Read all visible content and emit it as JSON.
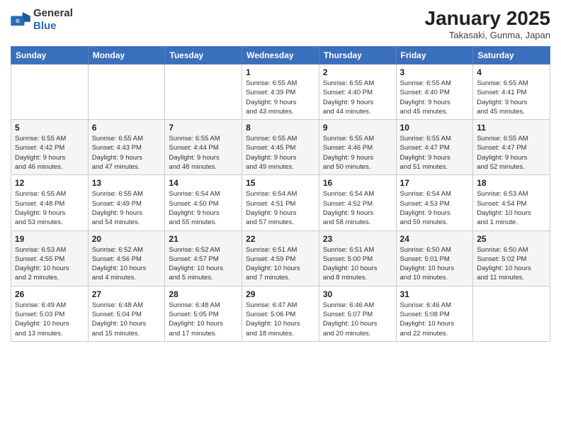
{
  "logo": {
    "general": "General",
    "blue": "Blue"
  },
  "header": {
    "month": "January 2025",
    "location": "Takasaki, Gunma, Japan"
  },
  "weekdays": [
    "Sunday",
    "Monday",
    "Tuesday",
    "Wednesday",
    "Thursday",
    "Friday",
    "Saturday"
  ],
  "weeks": [
    [
      {
        "day": "",
        "info": ""
      },
      {
        "day": "",
        "info": ""
      },
      {
        "day": "",
        "info": ""
      },
      {
        "day": "1",
        "info": "Sunrise: 6:55 AM\nSunset: 4:39 PM\nDaylight: 9 hours\nand 43 minutes."
      },
      {
        "day": "2",
        "info": "Sunrise: 6:55 AM\nSunset: 4:40 PM\nDaylight: 9 hours\nand 44 minutes."
      },
      {
        "day": "3",
        "info": "Sunrise: 6:55 AM\nSunset: 4:40 PM\nDaylight: 9 hours\nand 45 minutes."
      },
      {
        "day": "4",
        "info": "Sunrise: 6:55 AM\nSunset: 4:41 PM\nDaylight: 9 hours\nand 45 minutes."
      }
    ],
    [
      {
        "day": "5",
        "info": "Sunrise: 6:55 AM\nSunset: 4:42 PM\nDaylight: 9 hours\nand 46 minutes."
      },
      {
        "day": "6",
        "info": "Sunrise: 6:55 AM\nSunset: 4:43 PM\nDaylight: 9 hours\nand 47 minutes."
      },
      {
        "day": "7",
        "info": "Sunrise: 6:55 AM\nSunset: 4:44 PM\nDaylight: 9 hours\nand 48 minutes."
      },
      {
        "day": "8",
        "info": "Sunrise: 6:55 AM\nSunset: 4:45 PM\nDaylight: 9 hours\nand 49 minutes."
      },
      {
        "day": "9",
        "info": "Sunrise: 6:55 AM\nSunset: 4:46 PM\nDaylight: 9 hours\nand 50 minutes."
      },
      {
        "day": "10",
        "info": "Sunrise: 6:55 AM\nSunset: 4:47 PM\nDaylight: 9 hours\nand 51 minutes."
      },
      {
        "day": "11",
        "info": "Sunrise: 6:55 AM\nSunset: 4:47 PM\nDaylight: 9 hours\nand 52 minutes."
      }
    ],
    [
      {
        "day": "12",
        "info": "Sunrise: 6:55 AM\nSunset: 4:48 PM\nDaylight: 9 hours\nand 53 minutes."
      },
      {
        "day": "13",
        "info": "Sunrise: 6:55 AM\nSunset: 4:49 PM\nDaylight: 9 hours\nand 54 minutes."
      },
      {
        "day": "14",
        "info": "Sunrise: 6:54 AM\nSunset: 4:50 PM\nDaylight: 9 hours\nand 55 minutes."
      },
      {
        "day": "15",
        "info": "Sunrise: 6:54 AM\nSunset: 4:51 PM\nDaylight: 9 hours\nand 57 minutes."
      },
      {
        "day": "16",
        "info": "Sunrise: 6:54 AM\nSunset: 4:52 PM\nDaylight: 9 hours\nand 58 minutes."
      },
      {
        "day": "17",
        "info": "Sunrise: 6:54 AM\nSunset: 4:53 PM\nDaylight: 9 hours\nand 59 minutes."
      },
      {
        "day": "18",
        "info": "Sunrise: 6:53 AM\nSunset: 4:54 PM\nDaylight: 10 hours\nand 1 minute."
      }
    ],
    [
      {
        "day": "19",
        "info": "Sunrise: 6:53 AM\nSunset: 4:55 PM\nDaylight: 10 hours\nand 2 minutes."
      },
      {
        "day": "20",
        "info": "Sunrise: 6:52 AM\nSunset: 4:56 PM\nDaylight: 10 hours\nand 4 minutes."
      },
      {
        "day": "21",
        "info": "Sunrise: 6:52 AM\nSunset: 4:57 PM\nDaylight: 10 hours\nand 5 minutes."
      },
      {
        "day": "22",
        "info": "Sunrise: 6:51 AM\nSunset: 4:59 PM\nDaylight: 10 hours\nand 7 minutes."
      },
      {
        "day": "23",
        "info": "Sunrise: 6:51 AM\nSunset: 5:00 PM\nDaylight: 10 hours\nand 8 minutes."
      },
      {
        "day": "24",
        "info": "Sunrise: 6:50 AM\nSunset: 5:01 PM\nDaylight: 10 hours\nand 10 minutes."
      },
      {
        "day": "25",
        "info": "Sunrise: 6:50 AM\nSunset: 5:02 PM\nDaylight: 10 hours\nand 11 minutes."
      }
    ],
    [
      {
        "day": "26",
        "info": "Sunrise: 6:49 AM\nSunset: 5:03 PM\nDaylight: 10 hours\nand 13 minutes."
      },
      {
        "day": "27",
        "info": "Sunrise: 6:48 AM\nSunset: 5:04 PM\nDaylight: 10 hours\nand 15 minutes."
      },
      {
        "day": "28",
        "info": "Sunrise: 6:48 AM\nSunset: 5:05 PM\nDaylight: 10 hours\nand 17 minutes."
      },
      {
        "day": "29",
        "info": "Sunrise: 6:47 AM\nSunset: 5:06 PM\nDaylight: 10 hours\nand 18 minutes."
      },
      {
        "day": "30",
        "info": "Sunrise: 6:46 AM\nSunset: 5:07 PM\nDaylight: 10 hours\nand 20 minutes."
      },
      {
        "day": "31",
        "info": "Sunrise: 6:46 AM\nSunset: 5:08 PM\nDaylight: 10 hours\nand 22 minutes."
      },
      {
        "day": "",
        "info": ""
      }
    ]
  ]
}
